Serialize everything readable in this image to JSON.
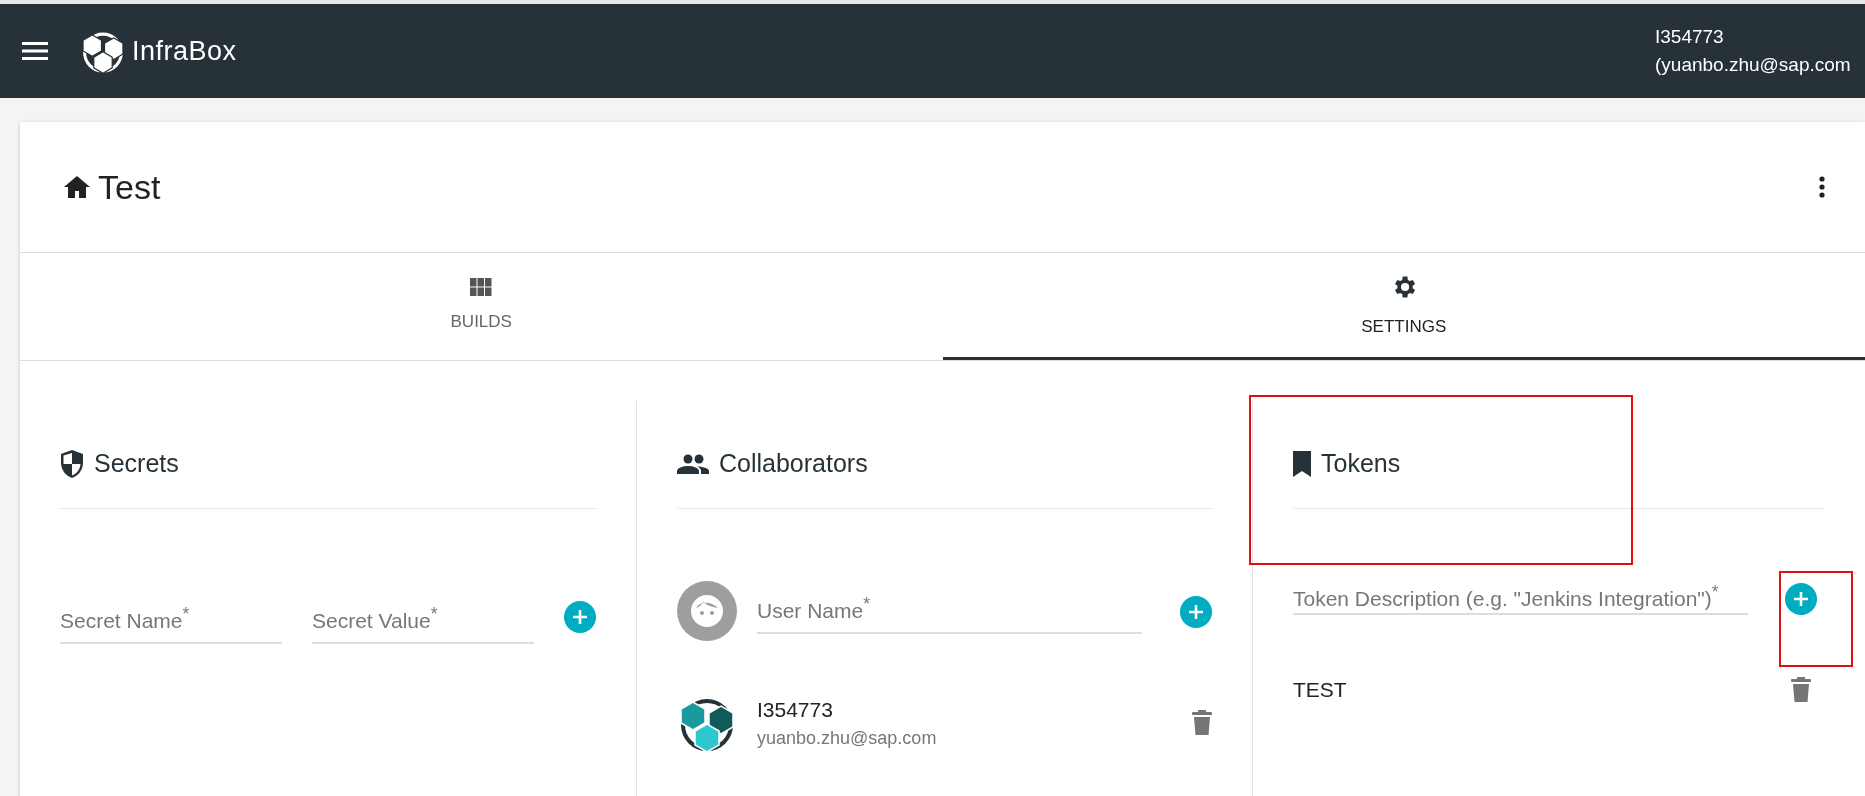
{
  "app": {
    "name": "InfraBox",
    "user_id": "I354773",
    "user_email": "(yuanbo.zhu@sap.com"
  },
  "project": {
    "title": "Test"
  },
  "tabs": [
    {
      "label": "BUILDS",
      "selected": false
    },
    {
      "label": "SETTINGS",
      "selected": true
    }
  ],
  "secrets": {
    "title": "Secrets",
    "fields": [
      {
        "placeholder": "Secret Name$^{*}$"
      },
      {
        "placeholder": "Secret Value$^{*}$"
      }
    ]
  },
  "collaborators": {
    "title": "Collaborators",
    "field": {
      "placeholder": "User Name$^{*}$"
    },
    "members": [
      {
        "name": "I354773",
        "email": "yuanbo.zhu@sap.com"
      }
    ]
  },
  "tokens": {
    "title": "Tokens",
    "field": {
      "placeholder": "Token Description (e.g. \"Jenkins Integration\")$^{*}$"
    },
    "items": [
      {
        "name": "TEST"
      }
    ]
  }
}
